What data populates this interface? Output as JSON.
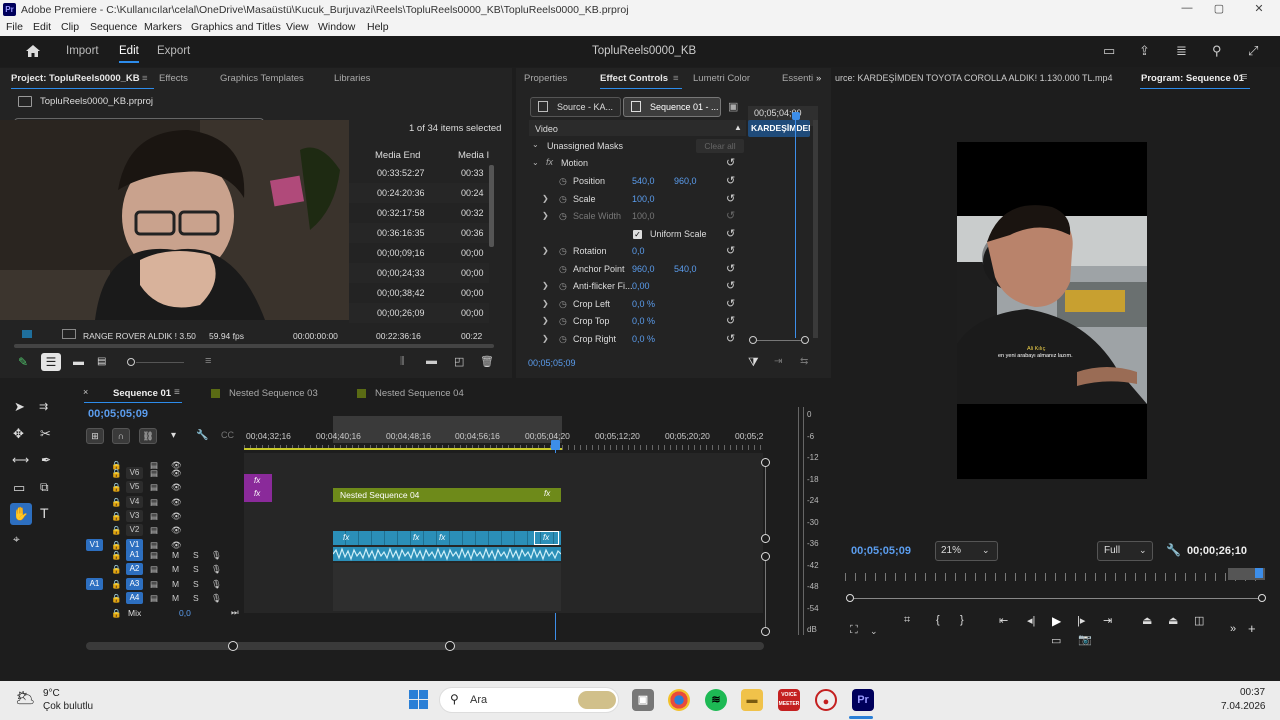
{
  "window": {
    "title": "Adobe Premiere - C:\\Kullanıcılar\\celal\\OneDrive\\Masaüstü\\Kucuk_Burjuvazi\\Reels\\TopluReels0000_KB\\TopluReels0000_KB.prproj",
    "minimize": "—",
    "maximize": "▢",
    "close": "✕"
  },
  "menu": [
    "File",
    "Edit",
    "Clip",
    "Sequence",
    "Markers",
    "Graphics and Titles",
    "View",
    "Window",
    "Help"
  ],
  "appbar": {
    "home_icon": "home-icon",
    "import": "Import",
    "edit": "Edit",
    "export": "Export",
    "project_title": "TopluReels0000_KB"
  },
  "project": {
    "tabs": [
      "Project: TopluReels0000_KB",
      "Effects",
      "Graphics Templates",
      "Libraries"
    ],
    "menu_glyph": "≡",
    "file": "TopluReels0000_KB.prproj",
    "items_selected": "1 of 34 items selected",
    "col_media_end": "Media End",
    "col_media_d": "Media I",
    "rows": [
      {
        "end": "00:33:52:27",
        "dur": "00:33"
      },
      {
        "end": "00:24:20:36",
        "dur": "00:24"
      },
      {
        "end": "00:32:17:58",
        "dur": "00:32"
      },
      {
        "end": "00:36:16:35",
        "dur": "00:36"
      },
      {
        "end": "00;00;09;16",
        "dur": "00;00"
      },
      {
        "end": "00;00;24;33",
        "dur": "00;00"
      },
      {
        "end": "00;00;38;42",
        "dur": "00;00"
      },
      {
        "end": "00;00;26;09",
        "dur": "00;00"
      },
      {
        "end": "00:22:36:16",
        "dur": "00:22"
      }
    ],
    "last_row": {
      "name": "RANGE ROVER ALDIK ! 3.50",
      "fps": "59.94 fps",
      "start": "00:00:00:00"
    }
  },
  "effect_controls": {
    "tabs": [
      "Properties",
      "Effect Controls",
      "Lumetri Color",
      "Essenti"
    ],
    "source_btn": "Source - KA...",
    "seq_btn": "Sequence 01 - ...",
    "timecode": "00;05;04;00",
    "clip_label": "KARDEŞİMDEN",
    "video": "Video",
    "masks": "Unassigned Masks",
    "clear_all": "Clear all",
    "motion": "Motion",
    "fx": "fx",
    "props": [
      {
        "label": "Position",
        "v1": "540,0",
        "v2": "960,0",
        "expand": false
      },
      {
        "label": "Scale",
        "v1": "100,0",
        "v2": "",
        "expand": true
      },
      {
        "label": "Scale Width",
        "v1": "100,0",
        "v2": "",
        "expand": true,
        "dim": true
      },
      {
        "label": "Uniform Scale",
        "v1": "",
        "v2": "",
        "expand": false,
        "check": true
      },
      {
        "label": "Rotation",
        "v1": "0,0",
        "v2": "",
        "expand": true
      },
      {
        "label": "Anchor Point",
        "v1": "960,0",
        "v2": "540,0",
        "expand": false
      },
      {
        "label": "Anti-flicker Fi...",
        "v1": "0,00",
        "v2": "",
        "expand": true
      },
      {
        "label": "Crop Left",
        "v1": "0,0 %",
        "v2": "",
        "expand": true
      },
      {
        "label": "Crop Top",
        "v1": "0,0 %",
        "v2": "",
        "expand": true
      },
      {
        "label": "Crop Right",
        "v1": "0,0 %",
        "v2": "",
        "expand": true
      }
    ],
    "footer_tc": "00;05;05;09"
  },
  "program": {
    "source_tab": "urce: KARDEŞİMDEN TOYOTA COROLLA ALDIK! 1.130.000 TL.mp4",
    "program_tab": "Program: Sequence 01",
    "timecode": "00;05;05;09",
    "zoom": "21%",
    "quality": "Full",
    "duration": "00;00;26;10",
    "caption_name": "Ali Kılıç",
    "caption_text": "en yeni arabayı almanız lazım."
  },
  "timeline": {
    "tabs": [
      "Sequence 01",
      "Nested Sequence 03",
      "Nested Sequence 04"
    ],
    "timecode": "00;05;05;09",
    "ruler": [
      "00;04;32;16",
      "00;04;40;16",
      "00;04;48;16",
      "00;04;56;16",
      "00;05;04;20",
      "00;05;12;20",
      "00;05;20;20",
      "00;05;2"
    ],
    "video_tracks": [
      "V6",
      "V5",
      "V4",
      "V3",
      "V2",
      "V1"
    ],
    "audio_tracks": [
      "A1",
      "A2",
      "A3",
      "A4"
    ],
    "mix": "Mix",
    "mix_val": "0,0",
    "nested_clip": "Nested Sequence 04",
    "m": "M",
    "s": "S"
  },
  "meter": {
    "labels": [
      "0",
      "-6",
      "-12",
      "-18",
      "-24",
      "-30",
      "-36",
      "-42",
      "-48",
      "-54",
      "dB"
    ]
  },
  "taskbar": {
    "temp": "9°C",
    "weather": "Çok bulutlu",
    "search": "Ara",
    "time": "00:37",
    "date": "7.04.2026",
    "voicemeeter": "VOICE MEETER"
  },
  "colors": {
    "accent": "#2d8ceb",
    "timecode": "#5b9dee",
    "clip_video": "#2b8fb8",
    "clip_nested": "#6e8a1a",
    "clip_fx": "#8a2a9a"
  }
}
